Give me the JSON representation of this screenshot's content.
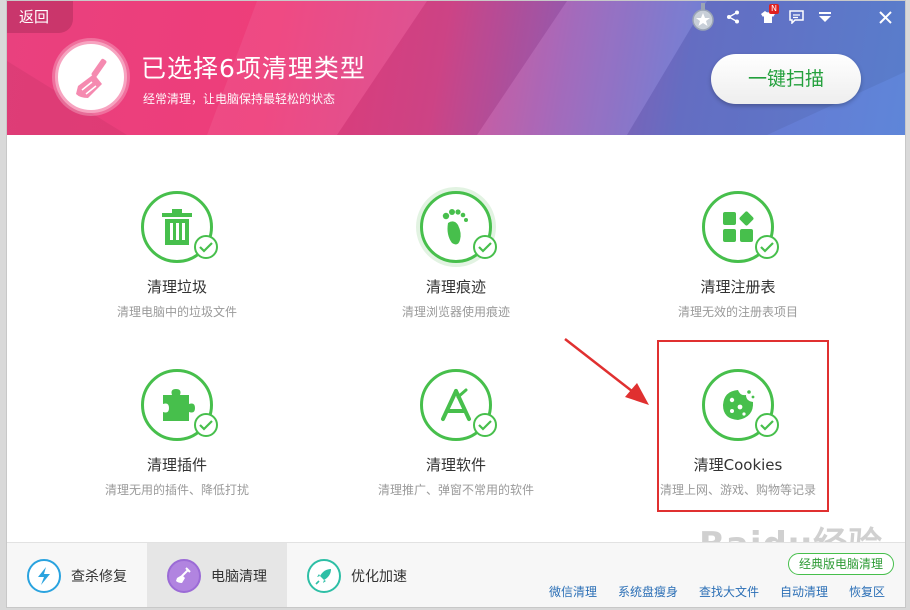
{
  "header": {
    "back_label": "返回",
    "title": "已选择6项清理类型",
    "subtitle": "经常清理，让电脑保持最轻松的状态",
    "scan_label": "一键扫描",
    "notify_badge": "N"
  },
  "tiles": [
    {
      "name": "清理垃圾",
      "desc": "清理电脑中的垃圾文件",
      "icon": "trash-can-icon"
    },
    {
      "name": "清理痕迹",
      "desc": "清理浏览器使用痕迹",
      "icon": "footprint-icon"
    },
    {
      "name": "清理注册表",
      "desc": "清理无效的注册表项目",
      "icon": "registry-blocks-icon"
    },
    {
      "name": "清理插件",
      "desc": "清理无用的插件、降低打扰",
      "icon": "puzzle-piece-icon"
    },
    {
      "name": "清理软件",
      "desc": "清理推广、弹窗不常用的软件",
      "icon": "app-store-icon"
    },
    {
      "name": "清理Cookies",
      "desc": "清理上网、游戏、购物等记录",
      "icon": "cookie-icon"
    }
  ],
  "footer": {
    "tabs": [
      {
        "label": "查杀修复",
        "icon": "lightning-shield-icon"
      },
      {
        "label": "电脑清理",
        "icon": "broom-icon"
      },
      {
        "label": "优化加速",
        "icon": "rocket-icon"
      }
    ],
    "classic_label": "经典版电脑清理",
    "links": [
      "微信清理",
      "系统盘瘦身",
      "查找大文件",
      "自动清理",
      "恢复区"
    ]
  },
  "watermark": "Baidu经验",
  "colors": {
    "accent_green": "#47bf4c",
    "header_pink": "#ee3d7a",
    "header_blue": "#5e86d9",
    "highlight_red": "#e03030"
  }
}
